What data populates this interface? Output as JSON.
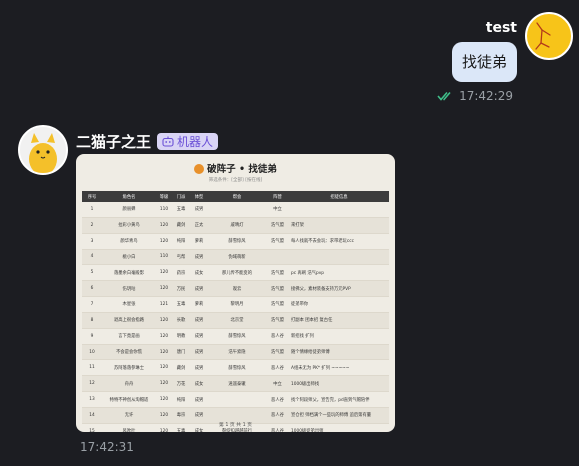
{
  "me": {
    "name": "test",
    "message": "找徒弟",
    "time": "17:42:29",
    "status_icon": "double-check-icon",
    "status_color": "#3fbf8a"
  },
  "bot": {
    "name": "二猫子之王",
    "tag": "机器人",
    "tag_icon": "robot-icon",
    "time": "17:42:31",
    "card": {
      "title": "破阵子 • 找徒弟",
      "subtitle": "筛选条件：[全部] [按在线]",
      "columns": [
        "序号",
        "角色名",
        "等级",
        "门派",
        "体型",
        "帮会",
        "阵营",
        "招徒信息"
      ],
      "rows": [
        [
          "1",
          "颜丽蝉",
          "110",
          "五毒",
          "成男",
          "",
          "中立",
          ""
        ],
        [
          "2",
          "拉彩小黄鸟",
          "120",
          "藏剑",
          "正太",
          "戚晴灯",
          "浩气盟",
          "来打架"
        ],
        [
          "3",
          "颜华青鸟",
          "120",
          "纯阳",
          "萝莉",
          "薛雪惊风",
          "浩气盟",
          "每人找就不去会玩：求带老玩ccc"
        ],
        [
          "4",
          "桃小白",
          "110",
          "丐帮",
          "成男",
          "伪域萌新",
          "",
          ""
        ],
        [
          "5",
          "落墨余白毫殿影",
          "120",
          "药宗",
          "成女",
          "那儿传不能变的",
          "浩气盟",
          "pc 再刷 浩气pvp"
        ],
        [
          "6",
          "伤玥咕",
          "120",
          "万民",
          "成男",
          "观云",
          "浩气盟",
          "接佛父，素材装备支持万元PVP"
        ],
        [
          "7",
          "木星张",
          "121",
          "五毒",
          "萝莉",
          "黎明月",
          "浩气盟",
          "徒弟带你"
        ],
        [
          "8",
          "退高上很会指路",
          "120",
          "长歌",
          "成男",
          "北京堂",
          "浩气盟",
          "打副本 团本招 复古任"
        ],
        [
          "9",
          "言下竟是画",
          "120",
          "明教",
          "成男",
          "薛雪惊风",
          "恶人谷",
          "新招找 扩列"
        ],
        [
          "10",
          "不会是会你慌",
          "120",
          "唐门",
          "成男",
          "浩午索隐",
          "浩气盟",
          "随个情缘给徒弟师傅"
        ],
        [
          "11",
          "苏阿落落参琳士",
          "120",
          "藏剑",
          "成男",
          "薛雪惊风",
          "恶人谷",
          "A组未无为 PK* 扩列 ~~~~~"
        ],
        [
          "12",
          "舟舟",
          "120",
          "万花",
          "成女",
          "逍遥泰辙",
          "中立",
          "1000级出师找"
        ],
        [
          "13",
          "特特不神创从淘帽适",
          "120",
          "纯阳",
          "成男",
          "",
          "恶人谷",
          "找个阿段师父，宣告完，pd直到气帽陪伴"
        ],
        [
          "14",
          "无许",
          "120",
          "毒宗",
          "成男",
          "",
          "恶人谷",
          "宣仓担 师档满个一些玩的师傅 追后第有量"
        ],
        [
          "15",
          "风吹叶",
          "120",
          "五毒",
          "成女",
          "裂绽扣越越前行",
          "恶人谷",
          "1000级徒弟出师"
        ]
      ],
      "pager": "第 1 页 共 1 页"
    }
  }
}
